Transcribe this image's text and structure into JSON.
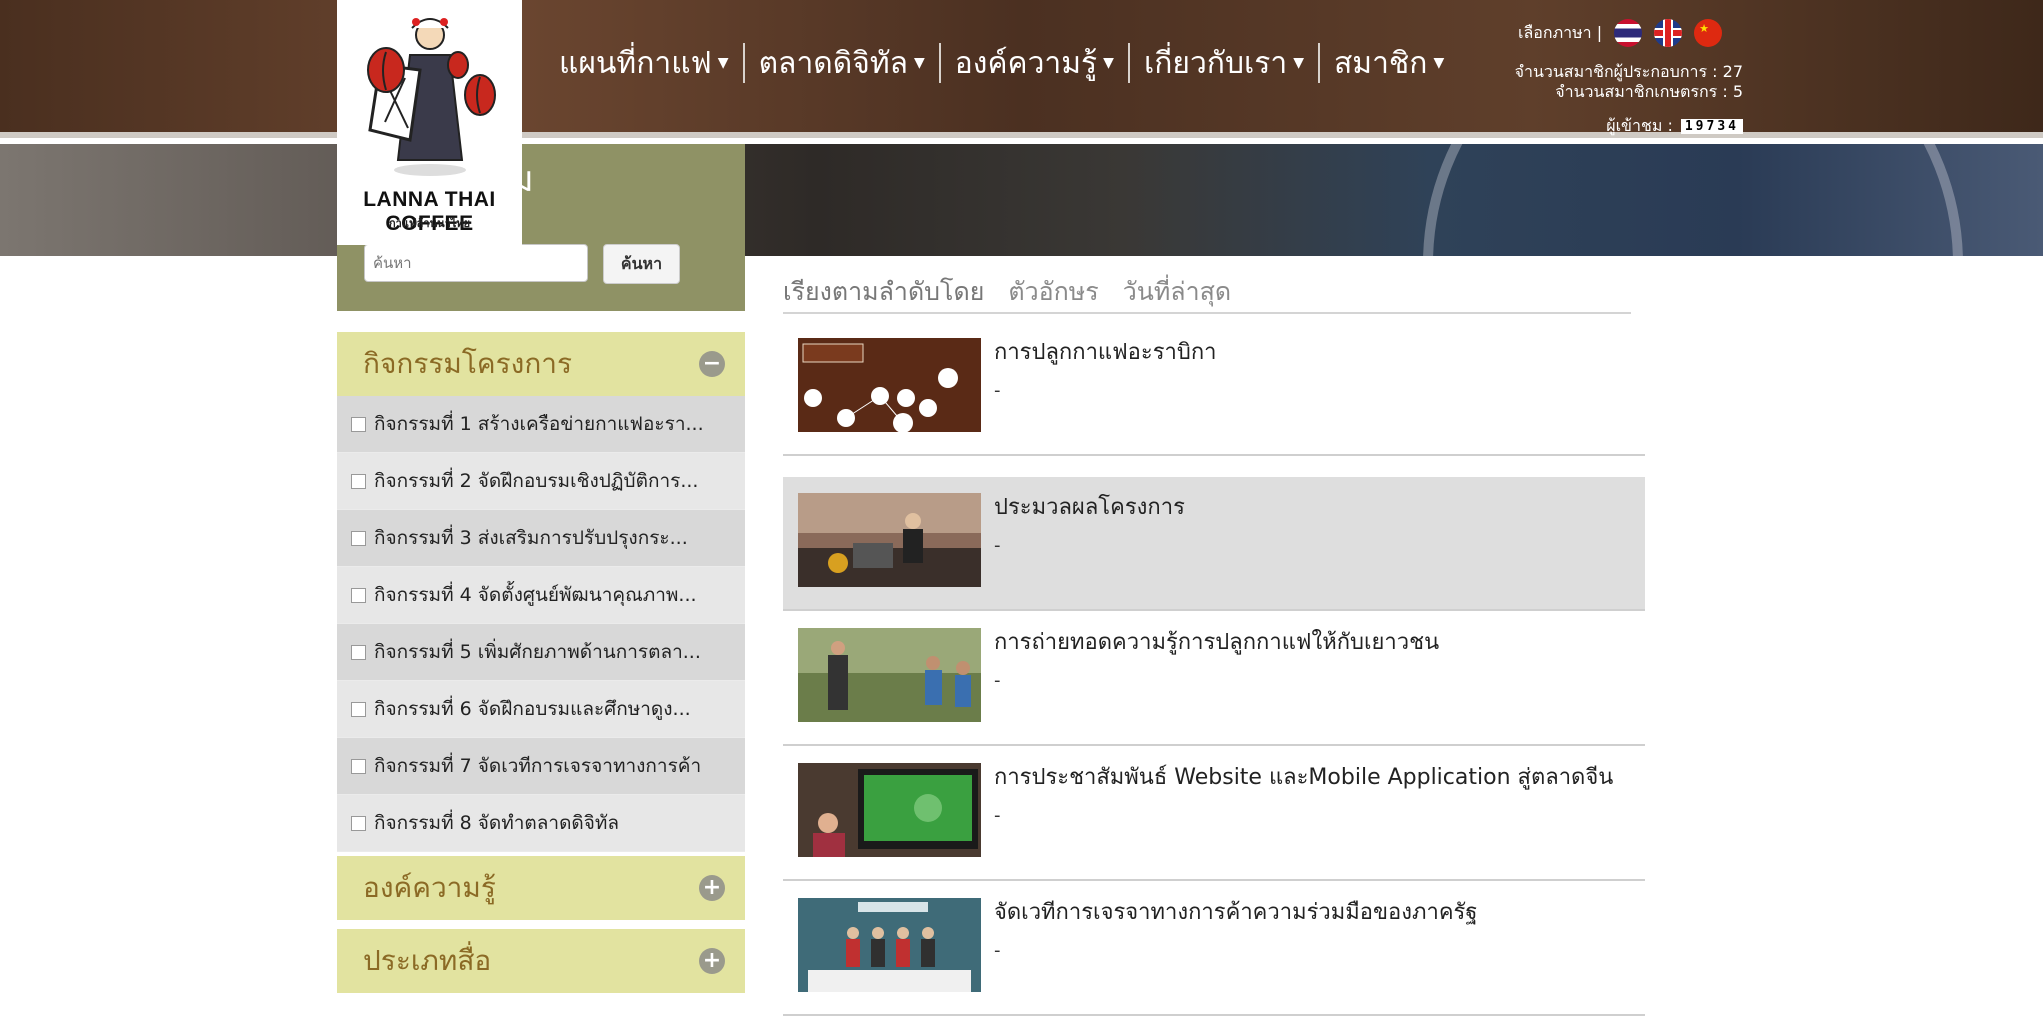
{
  "header": {
    "nav": [
      {
        "label": "แผนที่กาแฟ"
      },
      {
        "label": "ตลาดดิจิทัล"
      },
      {
        "label": "องค์ความรู้"
      },
      {
        "label": "เกี่ยวกับเรา"
      },
      {
        "label": "สมาชิก"
      }
    ],
    "language_label": "เลือกภาษา |",
    "stats": {
      "operators": "จำนวนสมาชิกผู้ประกอบการ : 27",
      "farmers": "จำนวนสมาชิกเกษตรกร : 5"
    },
    "visitors_label": "ผู้เข้าชม :",
    "visitors_count": "19734"
  },
  "logo": {
    "name": "LANNA THAI COFFEE",
    "subtitle": "กาแฟล้านนาไทย"
  },
  "search": {
    "title": "ม",
    "placeholder": "ค้นหา",
    "button": "ค้นหา"
  },
  "sidebar": {
    "activities_title": "กิจกรรมโครงการ",
    "items": [
      {
        "label": "กิจกรรมที่ 1 สร้างเครือข่ายกาแฟอะรา..."
      },
      {
        "label": "กิจกรรมที่ 2 จัดฝึกอบรมเชิงปฏิบัติการ..."
      },
      {
        "label": "กิจกรรมที่ 3 ส่งเสริมการปรับปรุงกระ..."
      },
      {
        "label": "กิจกรรมที่ 4 จัดตั้งศูนย์พัฒนาคุณภาพ..."
      },
      {
        "label": "กิจกรรมที่ 5 เพิ่มศักยภาพด้านการตลา..."
      },
      {
        "label": "กิจกรรมที่ 6 จัดฝึกอบรมและศึกษาดูง..."
      },
      {
        "label": "กิจกรรมที่ 7 จัดเวทีการเจรจาทางการค้า"
      },
      {
        "label": "กิจกรรมที่ 8 จัดทำตลาดดิจิทัล"
      }
    ],
    "knowledge_title": "องค์ความรู้",
    "media_title": "ประเภทสื่อ",
    "minus": "−",
    "plus": "+"
  },
  "sort": {
    "label": "เรียงตามลำดับโดย",
    "alpha": "ตัวอักษร",
    "latest": "วันที่ล่าสุด"
  },
  "articles": [
    {
      "title": "การปลูกกาแฟอะราบิกา",
      "desc": "-"
    },
    {
      "title": "ประมวลผลโครงการ",
      "desc": "-"
    },
    {
      "title": "การถ่ายทอดความรู้การปลูกกาแฟให้กับเยาวชน",
      "desc": "-"
    },
    {
      "title": "การประชาสัมพันธ์ Website และMobile Application สู่ตลาดจีน",
      "desc": "-"
    },
    {
      "title": "จัดเวทีการเจรจาทางการค้าความร่วมมือของภาครัฐ",
      "desc": "-"
    }
  ],
  "colors": {
    "header_brown": "#4a2f1f",
    "search_panel": "#8f9265",
    "sidebar_header": "#e2e3a0",
    "sidebar_title_text": "#8b6a25"
  }
}
